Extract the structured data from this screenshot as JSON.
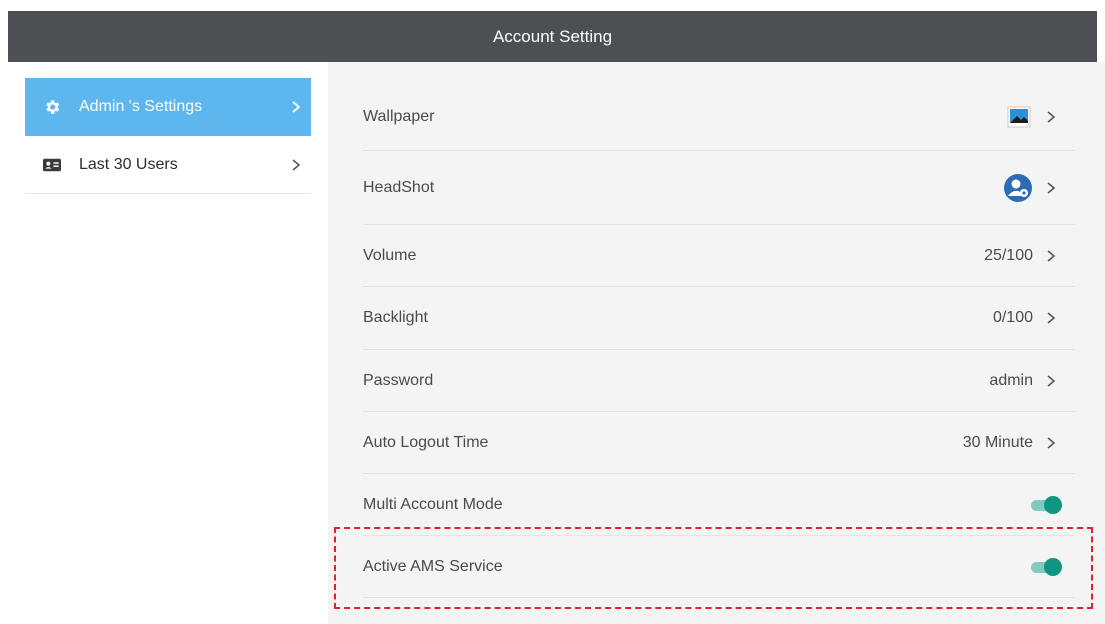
{
  "window": {
    "title": "Account Setting"
  },
  "sidebar": {
    "items": [
      {
        "label": "Admin 's Settings",
        "icon": "gear-icon",
        "active": true
      },
      {
        "label": "Last 30 Users",
        "icon": "id-card-icon",
        "active": false
      }
    ]
  },
  "settings": {
    "wallpaper": {
      "label": "Wallpaper",
      "icon": "image-icon"
    },
    "headshot": {
      "label": "HeadShot",
      "icon": "user-avatar-icon"
    },
    "volume": {
      "label": "Volume",
      "value": "25/100"
    },
    "backlight": {
      "label": "Backlight",
      "value": "0/100"
    },
    "password": {
      "label": "Password",
      "value": "admin"
    },
    "auto_logout": {
      "label": "Auto Logout Time",
      "value": "30 Minute"
    },
    "multi_account": {
      "label": "Multi Account Mode",
      "enabled": true
    },
    "active_ams": {
      "label": "Active AMS Service",
      "enabled": true
    }
  },
  "colors": {
    "titlebar": "#4d4f52",
    "sidebar_active": "#5db7ee",
    "toggle_on": "#0f9582",
    "highlight_border": "#e0222a"
  }
}
